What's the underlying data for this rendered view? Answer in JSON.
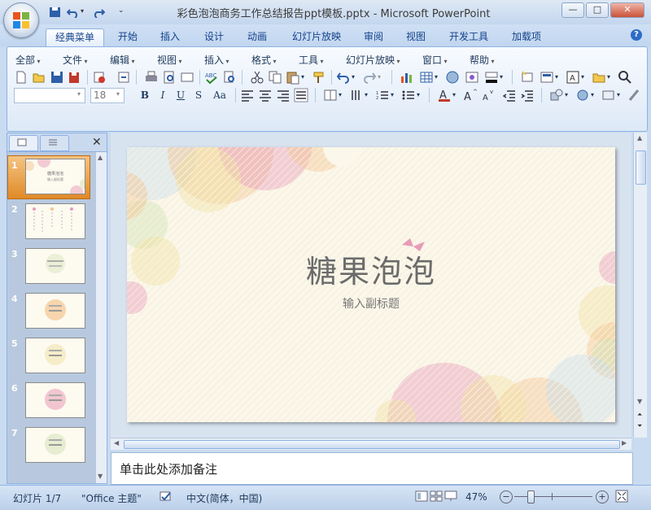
{
  "window": {
    "title": "彩色泡泡商务工作总结报告ppt模板.pptx - Microsoft PowerPoint",
    "minimize": "—",
    "maximize": "□",
    "close": "✕"
  },
  "ribbon_tabs": [
    "经典菜单",
    "开始",
    "插入",
    "设计",
    "动画",
    "幻灯片放映",
    "审阅",
    "视图",
    "开发工具",
    "加载项"
  ],
  "menu": [
    "全部",
    "文件",
    "编辑",
    "视图",
    "插入",
    "格式",
    "工具",
    "幻灯片放映",
    "窗口",
    "帮助"
  ],
  "format_bar": {
    "font_name": "",
    "font_size": "18",
    "bold": "B",
    "italic": "I",
    "underline": "U",
    "shadow": "S",
    "change_case": "Aa"
  },
  "slides": [
    {
      "num": "1",
      "title": "糖果泡泡",
      "subtitle": "输入副标题",
      "selected": true
    },
    {
      "num": "2",
      "title": "",
      "subtitle": ""
    },
    {
      "num": "3",
      "title": "",
      "subtitle": ""
    },
    {
      "num": "4",
      "title": "",
      "subtitle": ""
    },
    {
      "num": "5",
      "title": "",
      "subtitle": ""
    },
    {
      "num": "6",
      "title": "",
      "subtitle": ""
    },
    {
      "num": "7",
      "title": "",
      "subtitle": ""
    }
  ],
  "current_slide": {
    "title": "糖果泡泡",
    "subtitle": "输入副标题"
  },
  "notes": {
    "placeholder": "单击此处添加备注"
  },
  "status": {
    "slide_info": "幻灯片 1/7",
    "theme": "\"Office 主题\"",
    "language": "中文(简体，中国)",
    "zoom": "47%"
  },
  "colors": {
    "ribbon_accent": "#8db2e3",
    "bubble_pink": "#e79bb8",
    "bubble_orange": "#f3c490",
    "bubble_green": "#cfe0b0",
    "bubble_yellow": "#efe0a0",
    "bubble_blue": "#c7dde6"
  }
}
